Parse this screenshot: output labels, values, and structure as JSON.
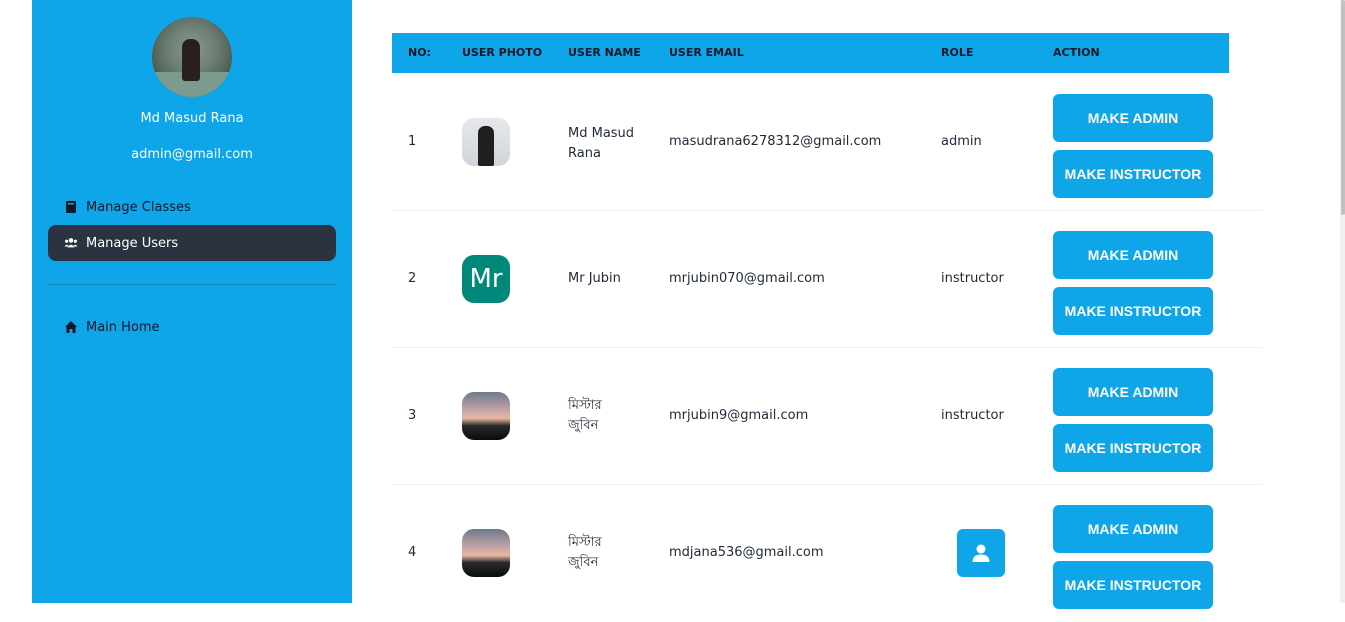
{
  "sidebar": {
    "profile": {
      "name": "Md Masud Rana",
      "email": "admin@gmail.com"
    },
    "items": [
      {
        "label": "Manage Classes",
        "icon": "book-icon",
        "active": false
      },
      {
        "label": "Manage Users",
        "icon": "users-icon",
        "active": true
      }
    ],
    "footer_items": [
      {
        "label": "Main Home",
        "icon": "home-icon"
      }
    ]
  },
  "table": {
    "headers": [
      "NO:",
      "USER PHOTO",
      "USER NAME",
      "USER EMAIL",
      "ROLE",
      "ACTION"
    ],
    "rows": [
      {
        "no": "1",
        "photo": "person-photo",
        "name_line1": "Md Masud",
        "name_line2": "Rana",
        "email": "masudrana6278312@gmail.com",
        "role": "admin"
      },
      {
        "no": "2",
        "photo": "initials",
        "initials": "Mr",
        "name_line1": "Mr Jubin",
        "name_line2": "",
        "email": "mrjubin070@gmail.com",
        "role": "instructor"
      },
      {
        "no": "3",
        "photo": "sunset-photo",
        "name_line1": "মিস্টার",
        "name_line2": "জুবিন",
        "email": "mrjubin9@gmail.com",
        "role": "instructor"
      },
      {
        "no": "4",
        "photo": "sunset-photo",
        "name_line1": "মিস্টার",
        "name_line2": "জুবিন",
        "email": "mdjana536@gmail.com",
        "role": ""
      }
    ],
    "actions": {
      "make_admin": "MAKE ADMIN",
      "make_instructor": "MAKE INSTRUCTOR"
    }
  },
  "colors": {
    "accent": "#0ea5e9",
    "active_menu": "#2b3240",
    "initials_bg": "#00897b"
  }
}
